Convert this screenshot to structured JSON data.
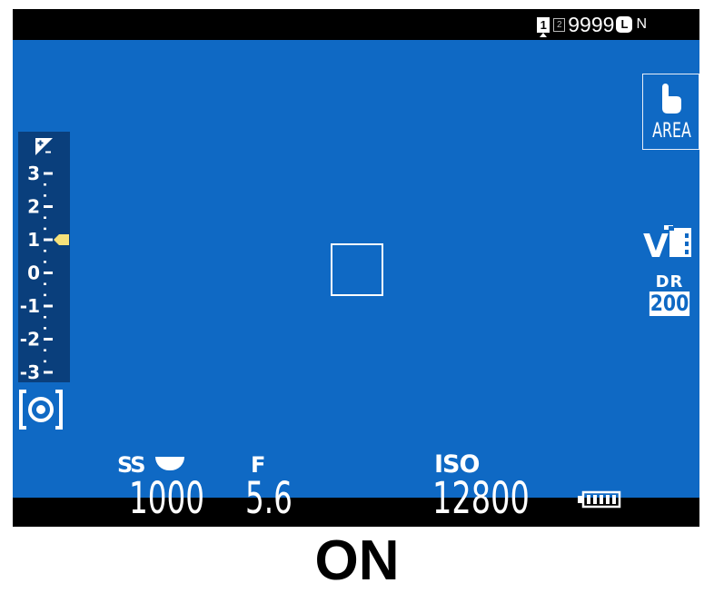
{
  "status": {
    "slot1": "1",
    "slot2": "2",
    "frames_remaining": "9999",
    "image_size": "L",
    "image_quality": "N"
  },
  "touch_mode": {
    "label": "AREA",
    "icon": "touch-hand-icon"
  },
  "film_simulation": {
    "label": "V",
    "icon": "film-simulation-velvia-icon"
  },
  "dynamic_range": {
    "label": "DR",
    "value": "200"
  },
  "exposure_compensation": {
    "icon": "exposure-compensation-icon",
    "scale_labels": [
      "3",
      "2",
      "1",
      "0",
      "-1",
      "-2",
      "-3"
    ],
    "current_value": 1
  },
  "metering": {
    "icon": "multi-metering-icon"
  },
  "focus_frame": {
    "icon": "af-frame"
  },
  "exposure": {
    "shutter_label": "SS",
    "shutter_value": "1000",
    "aperture_label": "F",
    "aperture_value": "5.6",
    "iso_label": "ISO",
    "iso_value": "12800"
  },
  "battery": {
    "icon": "battery-full-icon",
    "level": 1.0
  },
  "caption": "ON",
  "colors": {
    "screen": "#0f69c4",
    "scale": "#0a3f7c",
    "indicator": "#f6e17a"
  }
}
